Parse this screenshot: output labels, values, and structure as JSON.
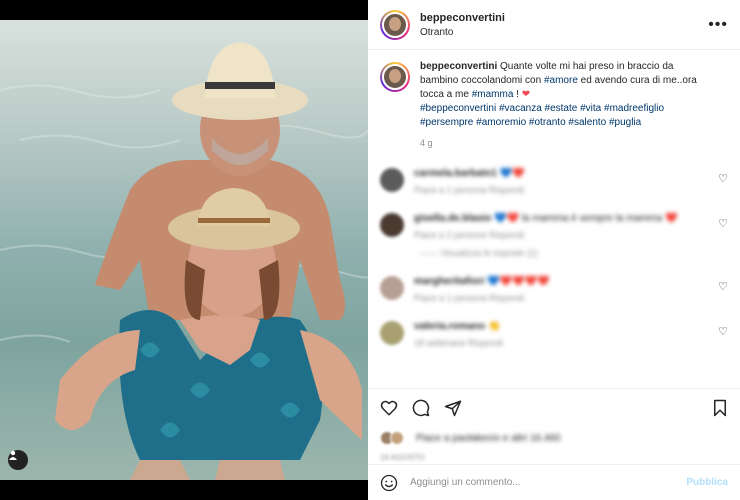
{
  "post": {
    "username": "beppeconvertini",
    "location": "Otranto",
    "more_icon": "more-horizontal-icon"
  },
  "caption": {
    "username": "beppeconvertini",
    "text_1": " Quante volte mi hai preso in braccio da bambino coccolandomi con ",
    "tag_amore": "#amore",
    "text_2": " ed avendo cura di me..ora tocca a me ",
    "tag_mamma": "#mamma",
    "text_3": " ! ",
    "heart": "❤",
    "hashtags": "#beppeconvertini #vacanza #estate #vita #madreefiglio #persempre #amoremio #otranto #salento #puglia",
    "time": "4 g"
  },
  "comments": [
    {
      "user": "carmela.barbato1",
      "text": "💙❤️",
      "meta": "Piace a 1 persona  Rispondi",
      "avatar_color": "#5b5b5b"
    },
    {
      "user": "gisella.de.blasio",
      "text": "💙❤️ la mamma è sempre la mamma ❤️",
      "meta": "Piace a 2 persone  Rispondi",
      "avatar_color": "#4a3a30",
      "replies": "——  Visualizza le risposte (1)"
    },
    {
      "user": "margheritafiori",
      "text": "💙❤️❤️❤️❤️",
      "meta": "Piace a 1 persona  Rispondi",
      "avatar_color": "#b89f96"
    },
    {
      "user": "valeria.romano",
      "text": "👏",
      "meta": "18 settimane  Rispondi",
      "avatar_color": "#a8a070"
    }
  ],
  "likes": {
    "text": "Piace a paolakecio e altri 16.460",
    "date": "16 AGOSTO"
  },
  "add_comment": {
    "placeholder": "Aggiungi un commento...",
    "publish_label": "Pubblica"
  },
  "colors": {
    "link": "#00376b",
    "heart": "#ed4956",
    "publish": "#b2dffc"
  }
}
